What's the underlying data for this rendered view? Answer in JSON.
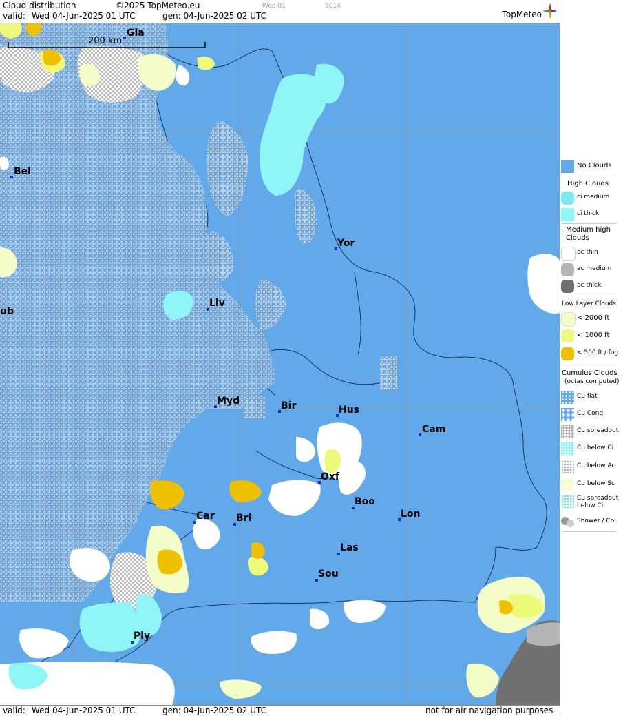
{
  "header": {
    "title": "Cloud distribution",
    "copyright": "©2025 TopMeteo.eu",
    "day_small": "Wed 01",
    "code_small": "9014",
    "valid_label": "valid:",
    "valid_value": "Wed  04-Jun-2025  01 UTC",
    "gen_value": "gen: 04-Jun-2025 02 UTC",
    "logo_text": "TopMeteo"
  },
  "map": {
    "scale_label": "200 km",
    "cities": [
      {
        "label": "Gla"
      },
      {
        "label": "Bel"
      },
      {
        "label": "Yor"
      },
      {
        "label": "Liv"
      },
      {
        "label": "ub"
      },
      {
        "label": "Myd"
      },
      {
        "label": "Bir"
      },
      {
        "label": "Hus"
      },
      {
        "label": "Cam"
      },
      {
        "label": "Oxf"
      },
      {
        "label": "Boo"
      },
      {
        "label": "Lon"
      },
      {
        "label": "Car"
      },
      {
        "label": "Bri"
      },
      {
        "label": "Las"
      },
      {
        "label": "Sou"
      },
      {
        "label": "Ply"
      }
    ]
  },
  "footer": {
    "valid_label": "valid:",
    "valid_value": "Wed  04-Jun-2025  01 UTC",
    "gen_value": "gen: 04-Jun-2025 02 UTC",
    "disclaimer": "not for air navigation purposes"
  },
  "legend": {
    "no_clouds": "No Clouds",
    "high_title": "High Clouds",
    "ci_medium": "ci medium",
    "ci_thick": "ci thick",
    "medium_title": "Medium high Clouds",
    "ac_thin": "ac thin",
    "ac_medium": "ac medium",
    "ac_thick": "ac thick",
    "low_title": "Low Layer Clouds",
    "low_2000": "< 2000 ft",
    "low_1000": "< 1000 ft",
    "low_500": "< 500 ft / fog",
    "cumulus_title": "Cumulus Clouds",
    "cumulus_sub": "(octas computed)",
    "cu_flat": "Cu flat",
    "cu_cong": "Cu Cong",
    "cu_spreadout": "Cu spreadout",
    "cu_below_ci": "Cu below Ci",
    "cu_below_ac": "Cu below Ac",
    "cu_below_sc": "Cu below Sc",
    "cu_spread_below_ci": "Cu spreadout below Ci",
    "shower_cb": "Shower / Cb"
  },
  "colors": {
    "sea_no_cloud": "#62a9ea",
    "ci_medium": "#7ee8f2",
    "ci_thick": "#8ef6f6",
    "ac_thin": "#ffffff",
    "ac_medium": "#b4b4b4",
    "ac_thick": "#707070",
    "low_2000": "#f4fcc8",
    "low_1000": "#eef87a",
    "low_500": "#eec000",
    "city_marker": "#1230b8"
  }
}
